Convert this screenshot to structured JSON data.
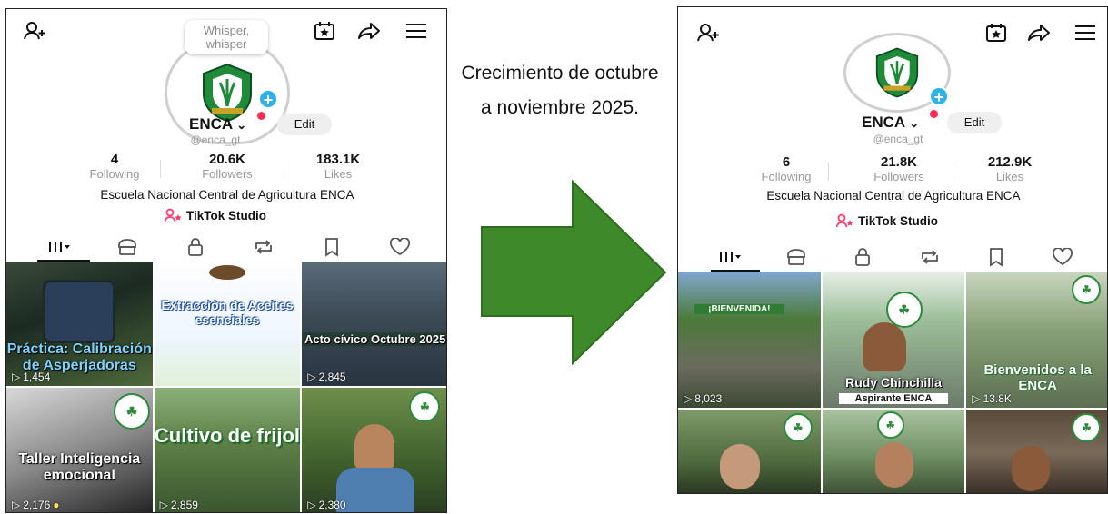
{
  "caption": "Crecimiento de octubre a noviembre 2025.",
  "colors": {
    "arrow": "#3e8a2b",
    "plus": "#2fb3e6",
    "dot": "#ff2d55",
    "studio": "#ff3b6b"
  },
  "left": {
    "whisper": "Whisper, whisper",
    "username": "ENCA",
    "edit": "Edit",
    "handle": "@enca_gt",
    "stats": {
      "following": "4",
      "following_label": "Following",
      "followers": "20.6K",
      "followers_label": "Followers",
      "likes": "183.1K",
      "likes_label": "Likes"
    },
    "bio": "Escuela Nacional Central de Agricultura ENCA",
    "studio": "TikTok Studio",
    "tiles": [
      {
        "caption": "Práctica: Calibración de Asperjadoras",
        "views": "1,454"
      },
      {
        "caption": "Extracción de Aceites esenciales",
        "views": ""
      },
      {
        "caption": "Acto cívico Octubre 2025",
        "views": "2,845"
      },
      {
        "caption": "Taller Inteligencia emocional",
        "views": "2,176"
      },
      {
        "caption": "Cultivo de frijol",
        "views": "2,859"
      },
      {
        "caption": "",
        "views": "2,380"
      }
    ]
  },
  "right": {
    "username": "ENCA",
    "edit": "Edit",
    "handle": "@enca_gt",
    "stats": {
      "following": "6",
      "following_label": "Following",
      "followers": "21.8K",
      "followers_label": "Followers",
      "likes": "212.9K",
      "likes_label": "Likes"
    },
    "bio": "Escuela Nacional Central de Agricultura ENCA",
    "studio": "TikTok Studio",
    "tiles": [
      {
        "caption": "¡BIENVENIDA!",
        "views": "8,023"
      },
      {
        "caption": "Rudy Chinchilla",
        "subcaption": "Aspirante ENCA",
        "views": ""
      },
      {
        "caption": "Bienvenidos a la ENCA",
        "views": "13.8K"
      },
      {
        "caption": "",
        "views": ""
      },
      {
        "caption": "",
        "views": ""
      },
      {
        "caption": "",
        "views": ""
      }
    ]
  }
}
